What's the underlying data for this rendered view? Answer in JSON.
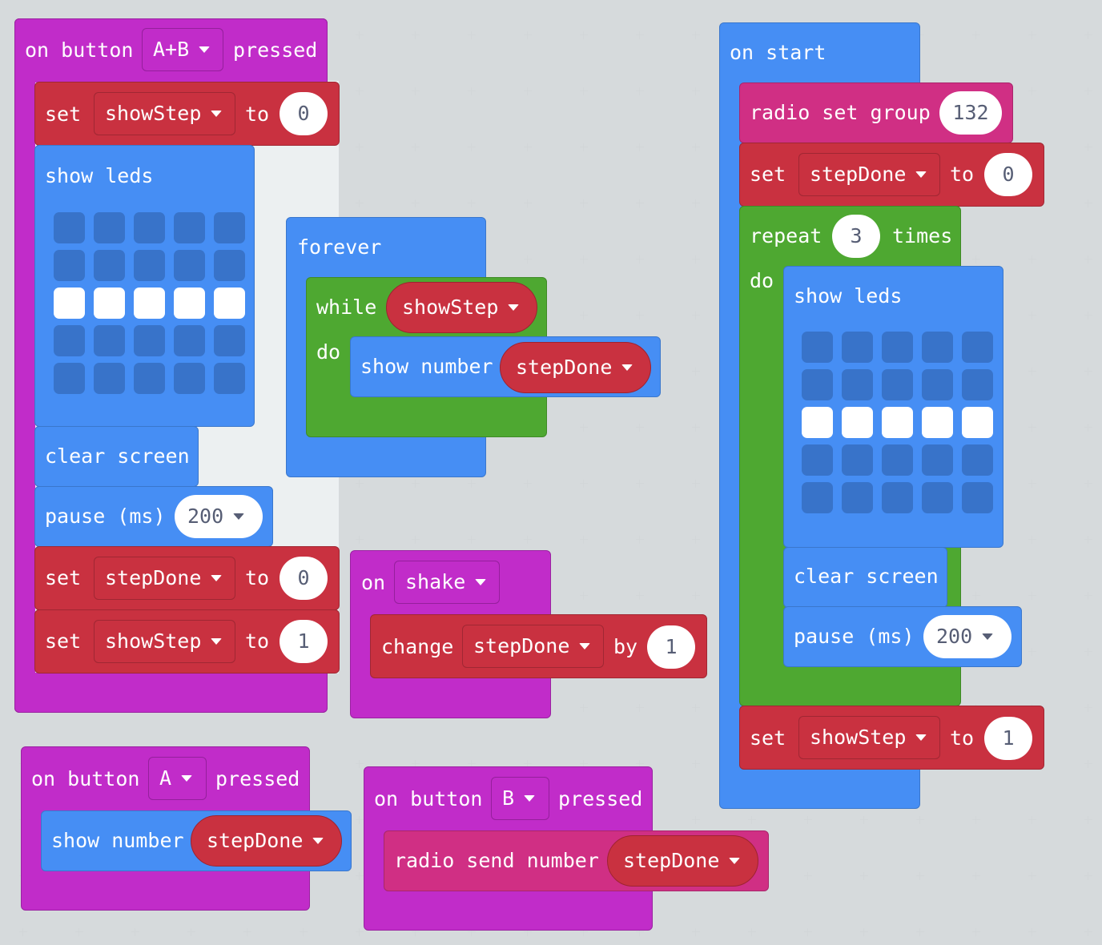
{
  "colors": {
    "background": "#ecf0f1",
    "events": "#c12cc9",
    "basic": "#468ef4",
    "variables": "#c93140",
    "loops": "#4ea831",
    "radio": "#d02f84",
    "led_off": "#3873c9",
    "led_on": "#ffffff"
  },
  "blocks": {
    "on_ab": {
      "prefix": "on button",
      "button": "A+B",
      "suffix": "pressed",
      "set1": {
        "keyword": "set",
        "variable": "showStep",
        "to": "to",
        "value": "0"
      },
      "show_leds": {
        "label": "show leds",
        "matrix": [
          [
            0,
            0,
            0,
            0,
            0
          ],
          [
            0,
            0,
            0,
            0,
            0
          ],
          [
            1,
            1,
            1,
            1,
            1
          ],
          [
            0,
            0,
            0,
            0,
            0
          ],
          [
            0,
            0,
            0,
            0,
            0
          ]
        ]
      },
      "clear_screen": "clear screen",
      "pause": {
        "label": "pause (ms)",
        "value": "200"
      },
      "set2": {
        "keyword": "set",
        "variable": "stepDone",
        "to": "to",
        "value": "0"
      },
      "set3": {
        "keyword": "set",
        "variable": "showStep",
        "to": "to",
        "value": "1"
      }
    },
    "forever": {
      "label": "forever",
      "while": "while",
      "condition": "showStep",
      "do": "do",
      "show_number": "show number",
      "variable": "stepDone"
    },
    "on_shake": {
      "prefix": "on",
      "gesture": "shake",
      "change": "change",
      "variable": "stepDone",
      "by": "by",
      "value": "1"
    },
    "on_start": {
      "label": "on start",
      "radio_group": {
        "label": "radio set group",
        "value": "132"
      },
      "set1": {
        "keyword": "set",
        "variable": "stepDone",
        "to": "to",
        "value": "0"
      },
      "repeat": {
        "label": "repeat",
        "count": "3",
        "times": "times",
        "do": "do"
      },
      "show_leds": {
        "label": "show leds",
        "matrix": [
          [
            0,
            0,
            0,
            0,
            0
          ],
          [
            0,
            0,
            0,
            0,
            0
          ],
          [
            1,
            1,
            1,
            1,
            1
          ],
          [
            0,
            0,
            0,
            0,
            0
          ],
          [
            0,
            0,
            0,
            0,
            0
          ]
        ]
      },
      "clear_screen": "clear screen",
      "pause": {
        "label": "pause (ms)",
        "value": "200"
      },
      "set2": {
        "keyword": "set",
        "variable": "showStep",
        "to": "to",
        "value": "1"
      }
    },
    "on_a": {
      "prefix": "on button",
      "button": "A",
      "suffix": "pressed",
      "show_number": "show number",
      "variable": "stepDone"
    },
    "on_b": {
      "prefix": "on button",
      "button": "B",
      "suffix": "pressed",
      "radio_send": "radio send number",
      "variable": "stepDone"
    }
  }
}
